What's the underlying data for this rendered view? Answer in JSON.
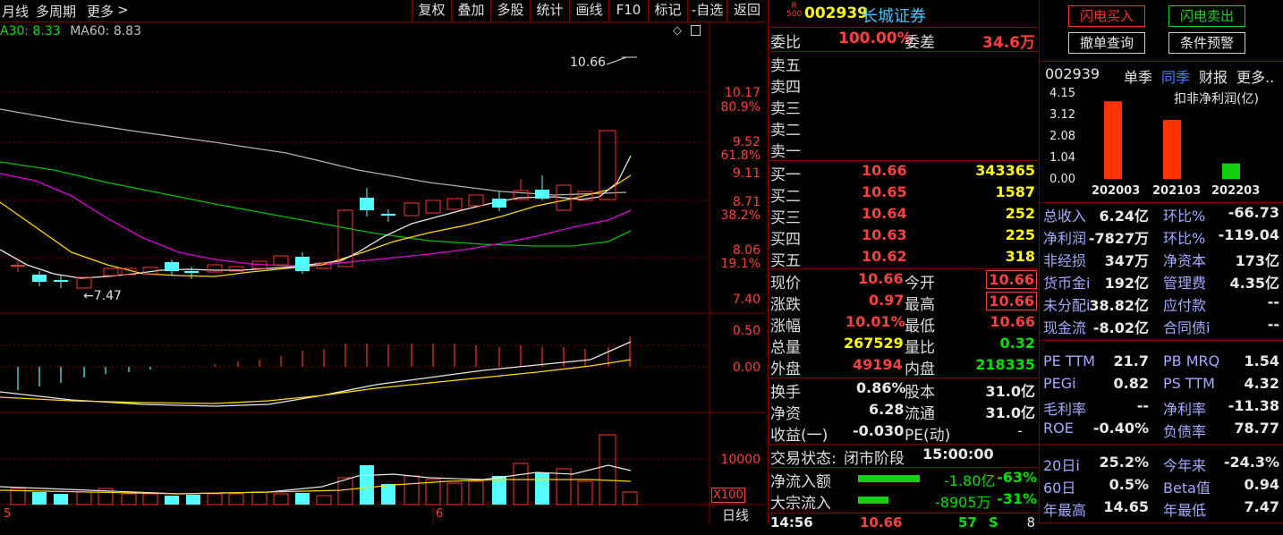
{
  "toolbar": {
    "period": "月线",
    "multi_period": "多周期",
    "more": "更多",
    "buttons": [
      "复权",
      "叠加",
      "多股",
      "统计",
      "画线",
      "F10",
      "标记",
      "-自选",
      "返回"
    ]
  },
  "ma_legend": {
    "ma30": "A30: 8.33",
    "ma60": "MA60: 8.83"
  },
  "price_axis": [
    "10.17",
    "80.9%",
    "9.52",
    "61.8%",
    "9.11",
    "8.71",
    "38.2%",
    "8.06",
    "19.1%",
    "7.40"
  ],
  "price_annotations": {
    "high": "10.66",
    "low": "7.47"
  },
  "macd_axis": [
    "0.50",
    "0.00"
  ],
  "volume_axis": [
    "10000",
    "X100"
  ],
  "x_axis": {
    "label_a": "5",
    "label_b": "6",
    "period_tag": "日线"
  },
  "colors": {
    "up": "#ff3232",
    "down": "#54ffff",
    "ma_white": "#e0e0e0",
    "ma_yellow": "#ffd700",
    "ma_magenta": "#ff00ff",
    "ma_green": "#00c000",
    "ma_gray": "#a0a0a0",
    "frame": "#800000"
  },
  "stock": {
    "badge_r": "R",
    "badge_500": "500",
    "code": "002939",
    "name": "长城证券"
  },
  "weibi": {
    "label": "委比",
    "value": "100.00%",
    "label2": "委差",
    "value2": "34.6万"
  },
  "sells": [
    "卖五",
    "卖四",
    "卖三",
    "卖二",
    "卖一"
  ],
  "buys": [
    {
      "label": "买一",
      "price": "10.66",
      "vol": "343365"
    },
    {
      "label": "买二",
      "price": "10.65",
      "vol": "1587"
    },
    {
      "label": "买三",
      "price": "10.64",
      "vol": "252"
    },
    {
      "label": "买四",
      "price": "10.63",
      "vol": "225"
    },
    {
      "label": "买五",
      "price": "10.62",
      "vol": "318"
    }
  ],
  "quote": [
    {
      "l1": "现价",
      "v1": "10.66",
      "l2": "今开",
      "v2": "10.66"
    },
    {
      "l1": "涨跌",
      "v1": "0.97",
      "l2": "最高",
      "v2": "10.66"
    },
    {
      "l1": "涨幅",
      "v1": "10.01%",
      "l2": "最低",
      "v2": "10.66"
    },
    {
      "l1": "总量",
      "v1": "267529",
      "l2": "量比",
      "v2": "0.32"
    },
    {
      "l1": "外盘",
      "v1": "49194",
      "l2": "内盘",
      "v2": "218335"
    }
  ],
  "quote2": [
    {
      "l1": "换手",
      "v1": "0.86%",
      "l2": "股本",
      "v2": "31.0亿"
    },
    {
      "l1": "净资",
      "v1": "6.28",
      "l2": "流通",
      "v2": "31.0亿"
    },
    {
      "l1": "收益(一)",
      "v1": "-0.030",
      "l2": "PE(动)",
      "v2": "-"
    }
  ],
  "trade_status": {
    "label": "交易状态:",
    "status": "闭市阶段",
    "time": "15:00:00"
  },
  "flow": [
    {
      "label": "净流入额",
      "value": "-1.80亿",
      "pct": "-63%",
      "bar": 0.63
    },
    {
      "label": "大宗流入",
      "value": "-8905万",
      "pct": "-31%",
      "bar": 0.31
    }
  ],
  "last_tick": {
    "time": "14:56",
    "price": "10.66",
    "vol": "57",
    "side": "S",
    "count": "8"
  },
  "fin": {
    "btn_buy": "闪电买入",
    "btn_sell": "闪电卖出",
    "btn_cancel": "撤单查询",
    "btn_cond": "条件预警",
    "code": "002939",
    "tab1": "单季",
    "tab2": "同季",
    "tab3": "财报",
    "tab4": "更多..",
    "chart_title": "扣非净利润(亿)",
    "rows": [
      {
        "l1": "总收入",
        "v1": "6.24亿",
        "l2": "环比%",
        "v2": "-66.73"
      },
      {
        "l1": "净利润",
        "v1": "-7827万",
        "l2": "环比%",
        "v2": "-119.04"
      },
      {
        "l1": "非经损",
        "v1": "347万",
        "l2": "净资本",
        "v2": "173亿"
      },
      {
        "l1": "货币金i",
        "v1": "192亿",
        "l2": "管理费",
        "v2": "4.35亿"
      },
      {
        "l1": "未分配i",
        "v1": "38.82亿",
        "l2": "应付款",
        "v2": "--"
      },
      {
        "l1": "现金流",
        "v1": "-8.02亿",
        "l2": "合同债i",
        "v2": "--"
      }
    ],
    "rows2": [
      {
        "l1": "PE TTM",
        "v1": "21.7",
        "l2": "PB MRQ",
        "v2": "1.54"
      },
      {
        "l1": "PEGi",
        "v1": "0.82",
        "l2": "PS TTM",
        "v2": "4.32"
      },
      {
        "l1": "毛利率",
        "v1": "--",
        "l2": "净利率",
        "v2": "-11.38"
      },
      {
        "l1": "ROE",
        "v1": "-0.40%",
        "l2": "负债率",
        "v2": "78.77"
      }
    ],
    "rows3": [
      {
        "l1": "20日i",
        "v1": "25.2%",
        "l2": "今年来",
        "v2": "-24.3%"
      },
      {
        "l1": "60日",
        "v1": "0.5%",
        "l2": "Beta值",
        "v2": "0.94"
      },
      {
        "l1": "年最高",
        "v1": "14.65",
        "l2": "年最低",
        "v2": "7.47"
      }
    ]
  },
  "chart_data": {
    "type": "bar",
    "title": "扣非净利润(亿)",
    "categories": [
      "202003",
      "202103",
      "202203"
    ],
    "values": [
      3.75,
      2.85,
      0.75
    ],
    "yticks": [
      "4.15",
      "3.12",
      "2.08",
      "1.04",
      "0.00"
    ],
    "ylim": [
      0,
      4.15
    ],
    "colors": [
      "#ff3200",
      "#ff3200",
      "#10d010"
    ]
  }
}
